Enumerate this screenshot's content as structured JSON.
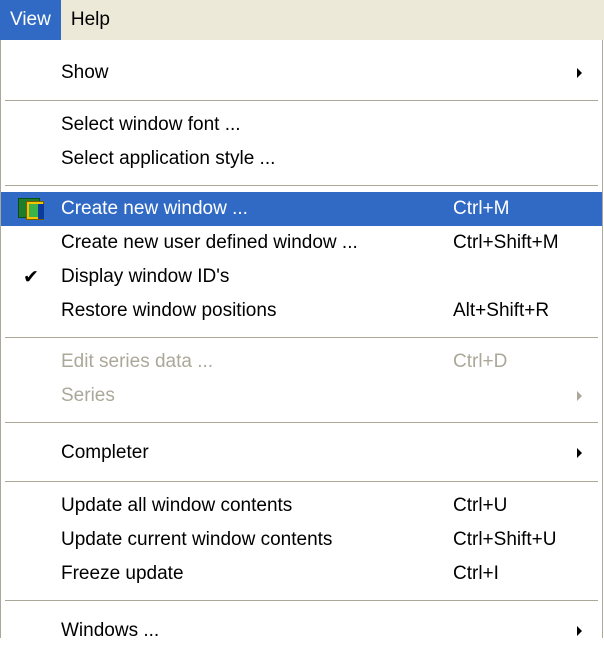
{
  "menubar": {
    "items": [
      {
        "label": "View",
        "active": true
      },
      {
        "label": "Help",
        "active": false
      }
    ]
  },
  "menu": {
    "items": [
      {
        "label": "Show",
        "shortcut": "",
        "submenu": true
      },
      {
        "label": "Select window font ...",
        "shortcut": "",
        "submenu": false
      },
      {
        "label": "Select application style ...",
        "shortcut": "",
        "submenu": false
      },
      {
        "label": "Create new window ...",
        "shortcut": "Ctrl+M",
        "submenu": false,
        "icon": "new-window-icon",
        "highlighted": true
      },
      {
        "label": "Create new user defined window ...",
        "shortcut": "Ctrl+Shift+M",
        "submenu": false
      },
      {
        "label": "Display window ID's",
        "shortcut": "",
        "submenu": false,
        "checked": true
      },
      {
        "label": "Restore window positions",
        "shortcut": "Alt+Shift+R",
        "submenu": false
      },
      {
        "label": "Edit series data ...",
        "shortcut": "Ctrl+D",
        "submenu": false,
        "disabled": true
      },
      {
        "label": "Series",
        "shortcut": "",
        "submenu": true,
        "disabled": true
      },
      {
        "label": "Completer",
        "shortcut": "",
        "submenu": true
      },
      {
        "label": "Update all window contents",
        "shortcut": "Ctrl+U",
        "submenu": false
      },
      {
        "label": "Update current window contents",
        "shortcut": "Ctrl+Shift+U",
        "submenu": false
      },
      {
        "label": "Freeze update",
        "shortcut": "Ctrl+I",
        "submenu": false
      },
      {
        "label": "Windows ...",
        "shortcut": "",
        "submenu": true
      }
    ],
    "check_glyph": "✔"
  },
  "colors": {
    "highlight": "#316ac5",
    "menubar_bg": "#ece9d8",
    "disabled_text": "#aca899",
    "separator": "#aca899"
  }
}
